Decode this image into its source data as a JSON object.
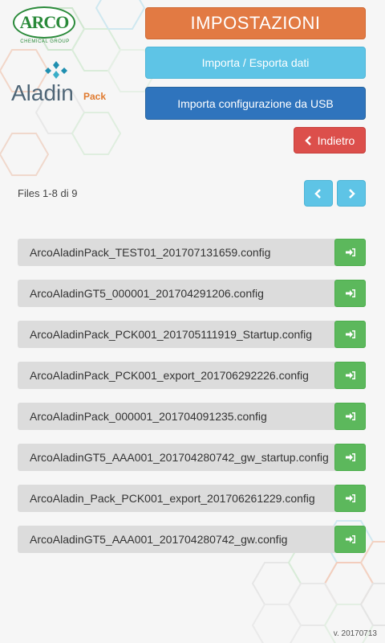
{
  "header": {
    "arco_logo_text": "ARCO",
    "arco_logo_sub": "CHEMICAL GROUP",
    "aladin_logo_text": "Aladin",
    "aladin_logo_sub": "Pack"
  },
  "buttons": {
    "settings": "IMPOSTAZIONI",
    "import_export": "Importa / Esporta dati",
    "import_usb": "Importa configurazione da USB",
    "back": "Indietro"
  },
  "pagination": {
    "files_count": "Files 1-8 di 9"
  },
  "files": [
    "ArcoAladinPack_TEST01_201707131659.config",
    "ArcoAladinGT5_000001_201704291206.config",
    "ArcoAladinPack_PCK001_201705111919_Startup.config",
    "ArcoAladinPack_PCK001_export_201706292226.config",
    "ArcoAladinPack_000001_201704091235.config",
    "ArcoAladinGT5_AAA001_201704280742_gw_startup.config",
    "ArcoAladin_Pack_PCK001_export_201706261229.config",
    "ArcoAladinGT5_AAA001_201704280742_gw.config"
  ],
  "icons": {
    "back": "chevron-left-icon",
    "prev": "chevron-left-icon",
    "next": "chevron-right-icon",
    "file_action": "sign-in-icon"
  },
  "colors": {
    "settings": "#e27a43",
    "import_export": "#5ec4e6",
    "import_usb": "#2f74bd",
    "back": "#dc4f4b",
    "pager": "#5ec4e6",
    "file_action": "#5cb85c"
  },
  "version": "v. 20170713"
}
